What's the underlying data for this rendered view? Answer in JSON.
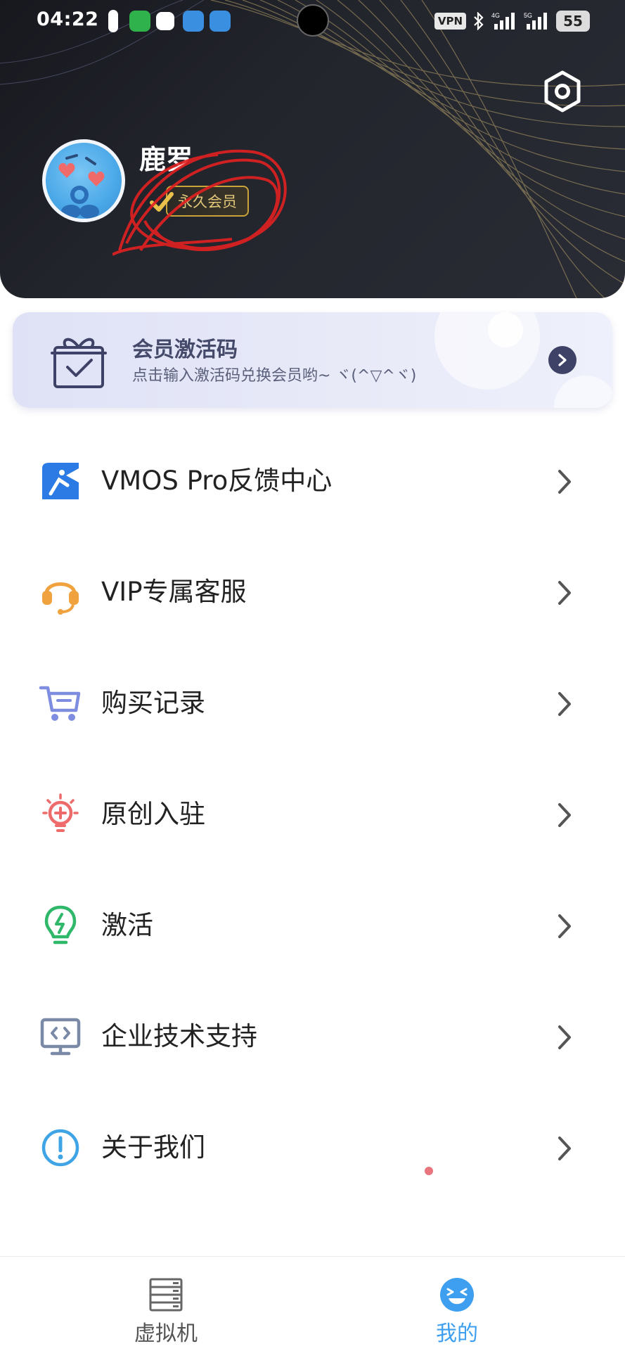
{
  "status_bar": {
    "time": "04:22",
    "vpn": "VPN",
    "signal_1": "4G",
    "signal_2": "5G",
    "battery": "55"
  },
  "profile": {
    "username": "鹿罗",
    "membership": "永久会员"
  },
  "activation_card": {
    "title": "会员激活码",
    "subtitle": "点击输入激活码兑换会员哟~ ヾ(^▽^ヾ)"
  },
  "menu": {
    "items": [
      {
        "label": "VMOS Pro反馈中心",
        "icon": "feedback-icon"
      },
      {
        "label": "VIP专属客服",
        "icon": "headset-icon"
      },
      {
        "label": "购买记录",
        "icon": "cart-icon"
      },
      {
        "label": "原创入驻",
        "icon": "lightbulb-plus-icon"
      },
      {
        "label": "激活",
        "icon": "bulb-bolt-icon"
      },
      {
        "label": "企业技术支持",
        "icon": "monitor-code-icon"
      },
      {
        "label": "关于我们",
        "icon": "info-icon"
      }
    ]
  },
  "bottom_nav": {
    "tabs": [
      {
        "label": "虚拟机",
        "icon": "server-icon",
        "active": false
      },
      {
        "label": "我的",
        "icon": "smile-face-icon",
        "active": true
      }
    ]
  },
  "colors": {
    "accent": "#3e9ff0",
    "header_bg": "#1c1d23",
    "vip_gold": "#c9a33a",
    "card_bg": "#e3e6f7"
  }
}
